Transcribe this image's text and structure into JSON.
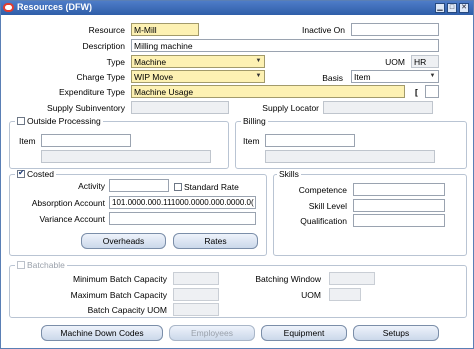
{
  "window": {
    "title": "Resources (DFW)"
  },
  "header": {
    "resource_label": "Resource",
    "resource_value": "M-Mill",
    "inactive_label": "Inactive On",
    "inactive_value": "",
    "description_label": "Description",
    "description_value": "Milling machine",
    "type_label": "Type",
    "type_value": "Machine",
    "uom_label": "UOM",
    "uom_value": "HR",
    "charge_type_label": "Charge Type",
    "charge_type_value": "WIP Move",
    "basis_label": "Basis",
    "basis_value": "Item",
    "expenditure_label": "Expenditure Type",
    "expenditure_value": "Machine Usage",
    "bracket_value": "[",
    "supply_subinv_label": "Supply Subinventory",
    "supply_subinv_value": "",
    "supply_locator_label": "Supply Locator",
    "supply_locator_value": ""
  },
  "outside_processing": {
    "title": "Outside Processing",
    "checked": false,
    "item_label": "Item",
    "item_value": "",
    "desc_value": ""
  },
  "billing": {
    "title": "Billing",
    "item_label": "Item",
    "item_value": "",
    "desc_value": ""
  },
  "costed": {
    "title": "Costed",
    "checked": true,
    "activity_label": "Activity",
    "activity_value": "",
    "standard_rate_label": "Standard Rate",
    "standard_rate_checked": false,
    "absorption_label": "Absorption Account",
    "absorption_value": "101.0000.000.111000.0000.000.0000.0(",
    "variance_label": "Variance Account",
    "variance_value": "",
    "overheads_button": "Overheads",
    "rates_button": "Rates"
  },
  "skills": {
    "title": "Skills",
    "competence_label": "Competence",
    "competence_value": "",
    "skill_level_label": "Skill Level",
    "skill_level_value": "",
    "qualification_label": "Qualification",
    "qualification_value": ""
  },
  "batchable": {
    "title": "Batchable",
    "checked": false,
    "min_label": "Minimum Batch Capacity",
    "min_value": "",
    "max_label": "Maximum Batch Capacity",
    "max_value": "",
    "uom_label": "Batch Capacity UOM",
    "uom_value": "",
    "window_label": "Batching Window",
    "window_value": "",
    "right_uom_label": "UOM",
    "right_uom_value": ""
  },
  "footer": {
    "machine_down_codes": "Machine Down Codes",
    "employees": "Employees",
    "equipment": "Equipment",
    "setups": "Setups"
  },
  "colors": {
    "title_bar": "#2f5ea8",
    "required_field": "#fdf1b3",
    "accent": "#1d3c78"
  }
}
